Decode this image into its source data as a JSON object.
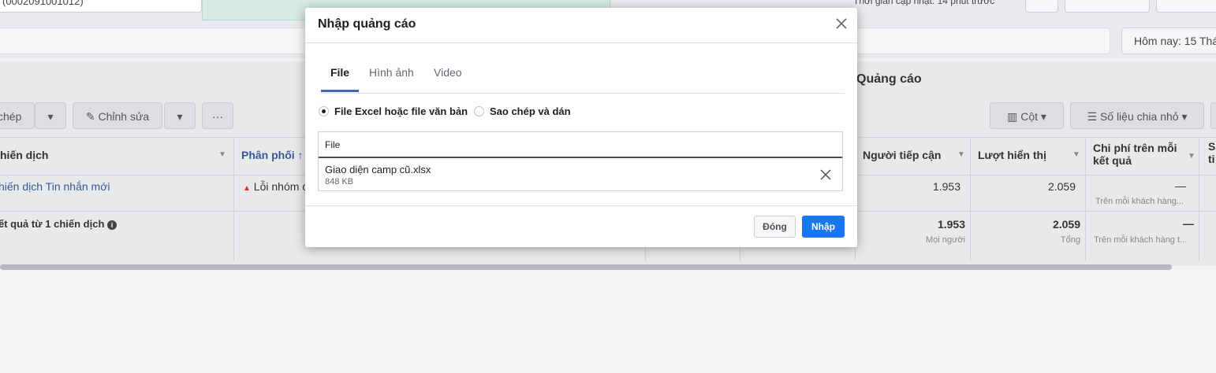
{
  "background": {
    "account_text": "(0002091001012)",
    "last_updated": "Thời gian cập nhật: 14 phút trước",
    "date_label": "Hôm nay: 15 Thá",
    "panel_title": "Quảng cáo",
    "toolbar": {
      "copy_label": "chép",
      "edit_label": "Chỉnh sửa",
      "more_label": "···",
      "columns_label": "Cột",
      "breakdown_label": "Số liệu chia nhỏ"
    },
    "table": {
      "headers": {
        "campaign": "hiến dịch",
        "delivery": "Phân phối ↑",
        "reach": "Người tiếp cận",
        "impressions": "Lượt hiển thị",
        "cost_per_result": "Chi phí trên mỗi kết quả",
        "extra": "S ti"
      },
      "rows": [
        {
          "campaign": "hiến dịch Tin nhắn mới",
          "delivery": "Lỗi nhóm c",
          "reach": "1.953",
          "impressions": "2.059",
          "cost_per_result": "—",
          "cost_sub": "Trên mỗi khách hàng..."
        }
      ],
      "summary": {
        "campaign": "ết quả từ 1 chiến dịch",
        "reach": "1.953",
        "reach_sub": "Mọi người",
        "impressions": "2.059",
        "impressions_sub": "Tổng",
        "cost_per_result": "—",
        "cost_sub": "Trên mỗi khách hàng t..."
      }
    }
  },
  "modal": {
    "title": "Nhập quảng cáo",
    "tabs": [
      {
        "label": "File",
        "active": true
      },
      {
        "label": "Hình ảnh",
        "active": false
      },
      {
        "label": "Video",
        "active": false
      }
    ],
    "options": [
      {
        "label": "File Excel hoặc file văn bản",
        "checked": true
      },
      {
        "label": "Sao chép và dán",
        "checked": false
      }
    ],
    "file_label": "File",
    "file_name": "Giao diện camp cũ.xlsx",
    "file_size": "848 KB",
    "close_label": "Đóng",
    "import_label": "Nhập"
  },
  "colors": {
    "primary": "#1877f2",
    "tab_indicator": "#4267b2",
    "link_blue": "#385898",
    "warning_red": "#d93025"
  }
}
